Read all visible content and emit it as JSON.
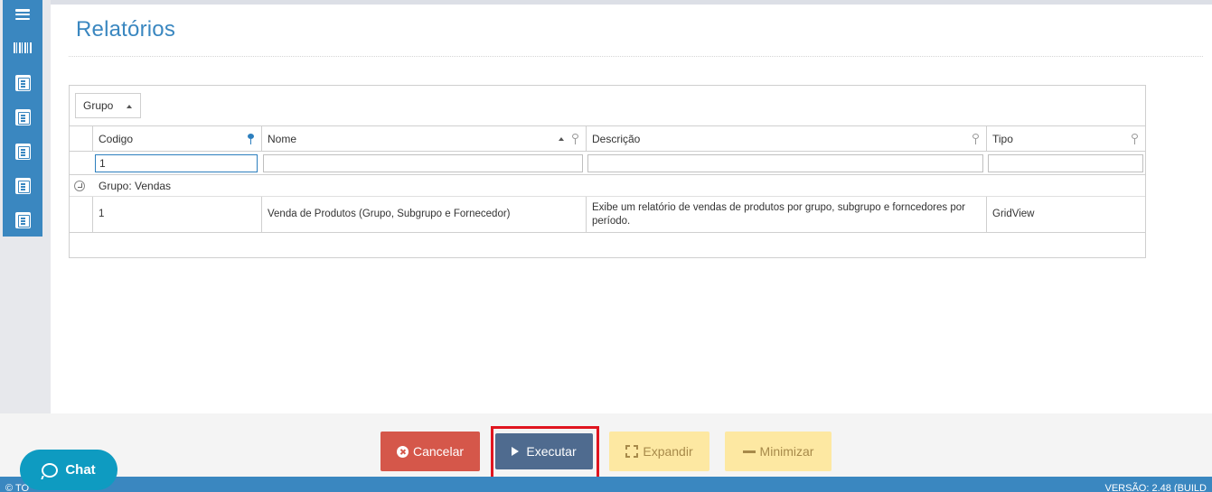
{
  "sidebar": {
    "icons": [
      "menu-icon",
      "barcode-icon",
      "report-icon",
      "report-icon",
      "report-icon",
      "report-icon",
      "report-icon"
    ]
  },
  "page": {
    "title": "Relatórios"
  },
  "grid": {
    "group_chip": "Grupo",
    "columns": [
      {
        "label": "Codigo",
        "filter": "1"
      },
      {
        "label": "Nome",
        "filter": ""
      },
      {
        "label": "Descrição",
        "filter": ""
      },
      {
        "label": "Tipo",
        "filter": ""
      }
    ],
    "group_row": "Grupo: Vendas",
    "rows": [
      {
        "codigo": "1",
        "nome": "Venda de Produtos (Grupo, Subgrupo e Fornecedor)",
        "descricao": "Exibe um relatório de vendas de produtos por grupo, subgrupo e forncedores por período.",
        "tipo": "GridView"
      }
    ]
  },
  "footer": {
    "cancel_label": "Cancelar",
    "execute_label": "Executar",
    "expand_label": "Expandir",
    "minimize_label": "Minimizar"
  },
  "statusbar": {
    "left": "© TO",
    "right": "VERSÃO: 2.48 (BUILD"
  },
  "chat": {
    "label": "Chat"
  },
  "colors": {
    "primary": "#3a87c0",
    "cancel": "#d5574a",
    "execute": "#4f6b8f",
    "warning": "#fde8a2",
    "highlight": "#e0151f"
  }
}
